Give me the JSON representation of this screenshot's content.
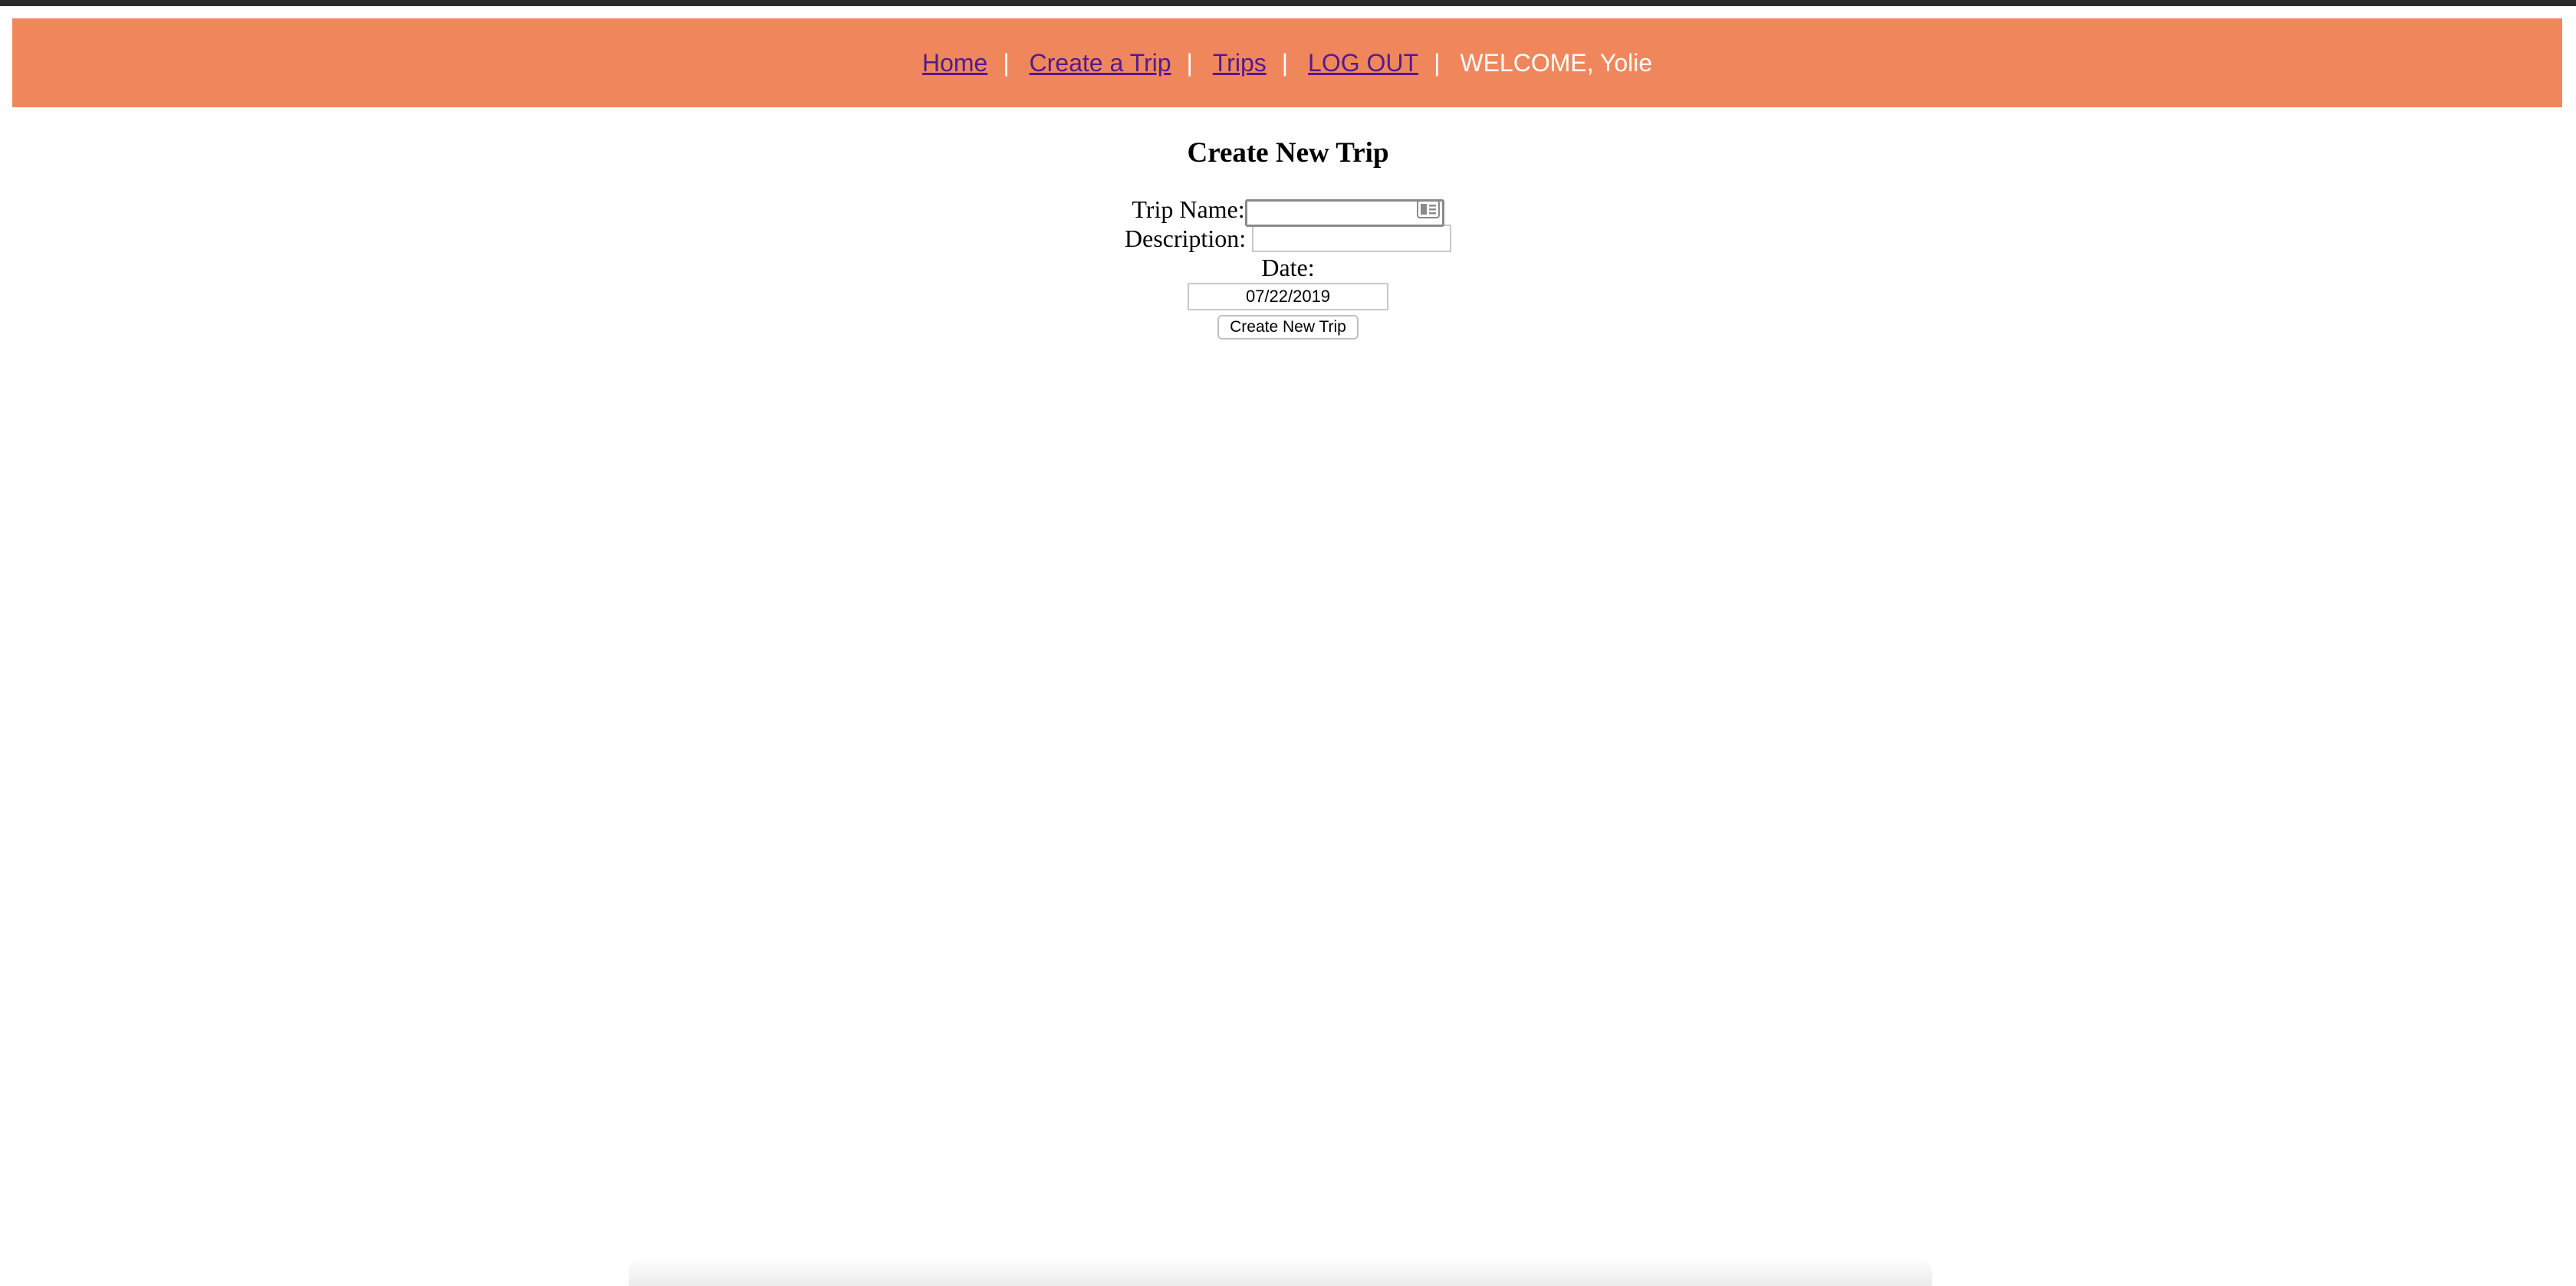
{
  "nav": {
    "home": "Home",
    "create_trip": "Create a Trip",
    "trips": "Trips",
    "logout": "LOG OUT",
    "separator": "|",
    "welcome": "WELCOME, Yolie"
  },
  "form": {
    "title": "Create New Trip",
    "trip_name_label": "Trip Name:",
    "trip_name_value": "",
    "description_label": "Description:",
    "description_value": "",
    "date_label": "Date:",
    "date_value": "07/22/2019",
    "submit_label": "Create New Trip"
  },
  "icons": {
    "autofill": "contact-card-icon"
  },
  "colors": {
    "nav_background": "#f0875c",
    "link": "#551a8b",
    "top_bar": "#2b2b2b"
  }
}
